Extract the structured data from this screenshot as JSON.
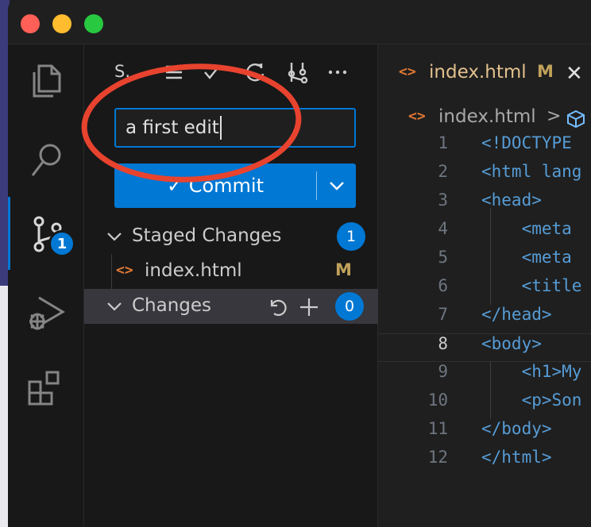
{
  "source_control": {
    "title": "S.",
    "commit_message": "a first edit",
    "commit_button_label": "✓ Commit",
    "staged_group": {
      "label": "Staged Changes",
      "count": "1"
    },
    "staged_files": [
      {
        "name": "index.html",
        "status": "M"
      }
    ],
    "changes_group": {
      "label": "Changes",
      "count": "0"
    }
  },
  "activity_bar": {
    "source_control_badge": "1"
  },
  "editor": {
    "tab": {
      "filename": "index.html",
      "status": "M",
      "close": "✕"
    },
    "breadcrumb": {
      "file": "index.html",
      "separator": ">"
    },
    "current_line": 8,
    "lines": [
      {
        "num": "1",
        "code": "<!DOCTYPE"
      },
      {
        "num": "2",
        "code": "<html lang"
      },
      {
        "num": "3",
        "code": "<head>"
      },
      {
        "num": "4",
        "code": "    <meta"
      },
      {
        "num": "5",
        "code": "    <meta"
      },
      {
        "num": "6",
        "code": "    <title"
      },
      {
        "num": "7",
        "code": "</head>"
      },
      {
        "num": "8",
        "code": "<body>"
      },
      {
        "num": "9",
        "code": "    <h1>My"
      },
      {
        "num": "10",
        "code": "    <p>Son"
      },
      {
        "num": "11",
        "code": "</body>"
      },
      {
        "num": "12",
        "code": "</html>"
      }
    ]
  },
  "colors": {
    "accent": "#0078d4",
    "annotation": "#e8432f",
    "modified": "#c0a25a"
  }
}
